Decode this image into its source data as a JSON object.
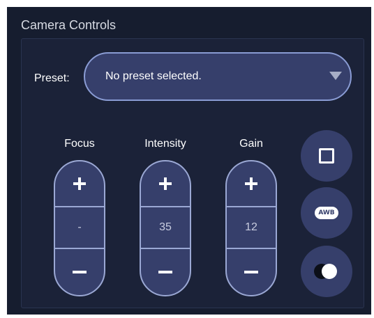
{
  "panel": {
    "title": "Camera Controls"
  },
  "preset": {
    "label": "Preset:",
    "selected_value": "No preset selected."
  },
  "controls": [
    {
      "label": "Focus",
      "value": "-",
      "increment_icon": "plus-icon",
      "decrement_icon": "minus-icon"
    },
    {
      "label": "Intensity",
      "value": "35",
      "increment_icon": "plus-icon",
      "decrement_icon": "minus-icon"
    },
    {
      "label": "Gain",
      "value": "12",
      "increment_icon": "plus-icon",
      "decrement_icon": "minus-icon"
    }
  ],
  "side_buttons": [
    {
      "icon": "square-icon"
    },
    {
      "icon": "awb-icon",
      "text": "AWB"
    },
    {
      "icon": "contrast-icon"
    }
  ],
  "colors": {
    "background": "#161d2f",
    "panel": "#1b2238",
    "button_fill": "#363f6b",
    "button_border": "#9ba8d4",
    "select_border": "#8a9cd4"
  }
}
